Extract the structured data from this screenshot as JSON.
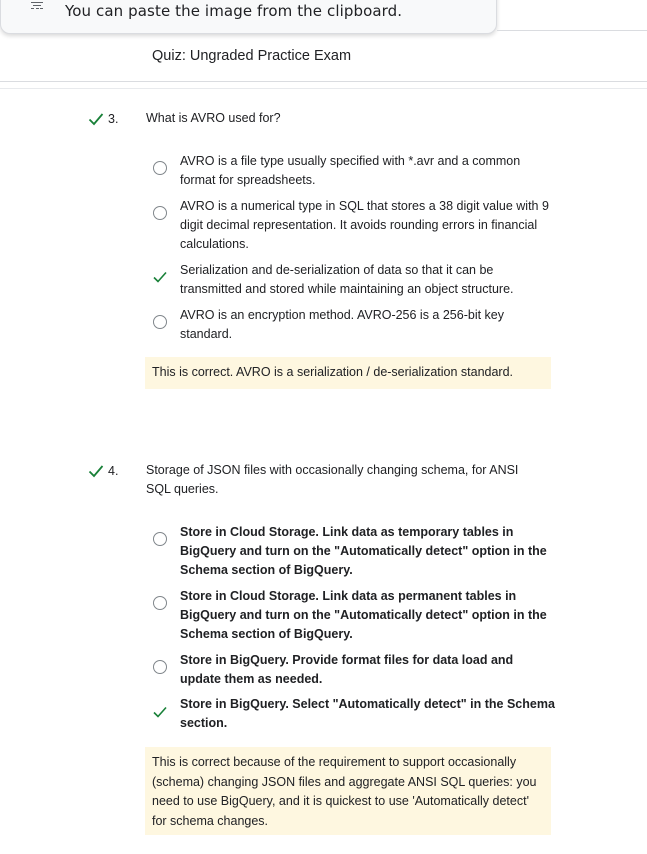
{
  "popup": {
    "text": "You can paste the image from the clipboard.",
    "icon": "clipboard-icon"
  },
  "header": {
    "title": "Quiz: Ungraded Practice Exam"
  },
  "questions": [
    {
      "number": "3.",
      "text": "What is AVRO used for?",
      "status": "correct",
      "options": [
        {
          "text": "AVRO is a file type usually specified with *.avr and a common format for spreadsheets.",
          "state": "unselected"
        },
        {
          "text": "AVRO is a numerical type in SQL that stores a 38 digit value with 9 digit decimal representation. It avoids rounding errors in financial calculations.",
          "state": "unselected"
        },
        {
          "text": "Serialization and de-serialization of data so that it can be transmitted and stored while maintaining an object structure.",
          "state": "correct"
        },
        {
          "text": "AVRO is an encryption method. AVRO-256 is a 256-bit key standard.",
          "state": "unselected"
        }
      ],
      "feedback": "This is correct. AVRO is a serialization / de-serialization standard."
    },
    {
      "number": "4.",
      "text": "Storage of JSON files with occasionally changing schema, for ANSI SQL queries.",
      "status": "correct",
      "options": [
        {
          "text": "Store in Cloud Storage. Link data as temporary tables in BigQuery and turn on the \"Automatically detect\" option in the Schema section of BigQuery.",
          "state": "unselected"
        },
        {
          "text": "Store in Cloud Storage. Link data as permanent tables in BigQuery and turn on the \"Automatically detect\" option in the Schema section of BigQuery.",
          "state": "unselected"
        },
        {
          "text": "Store in BigQuery. Provide format files for data load and update them as needed.",
          "state": "unselected"
        },
        {
          "text": "Store in BigQuery. Select \"Automatically detect\" in the Schema section.",
          "state": "correct"
        }
      ],
      "feedback": "This is correct because of the requirement to support occasionally (schema) changing JSON files and aggregate ANSI SQL queries: you need to use BigQuery, and it is quickest to use 'Automatically detect' for schema changes."
    }
  ],
  "colors": {
    "check": "#188038",
    "feedback_bg": "#fef7e0",
    "radio_border": "#80868b"
  }
}
